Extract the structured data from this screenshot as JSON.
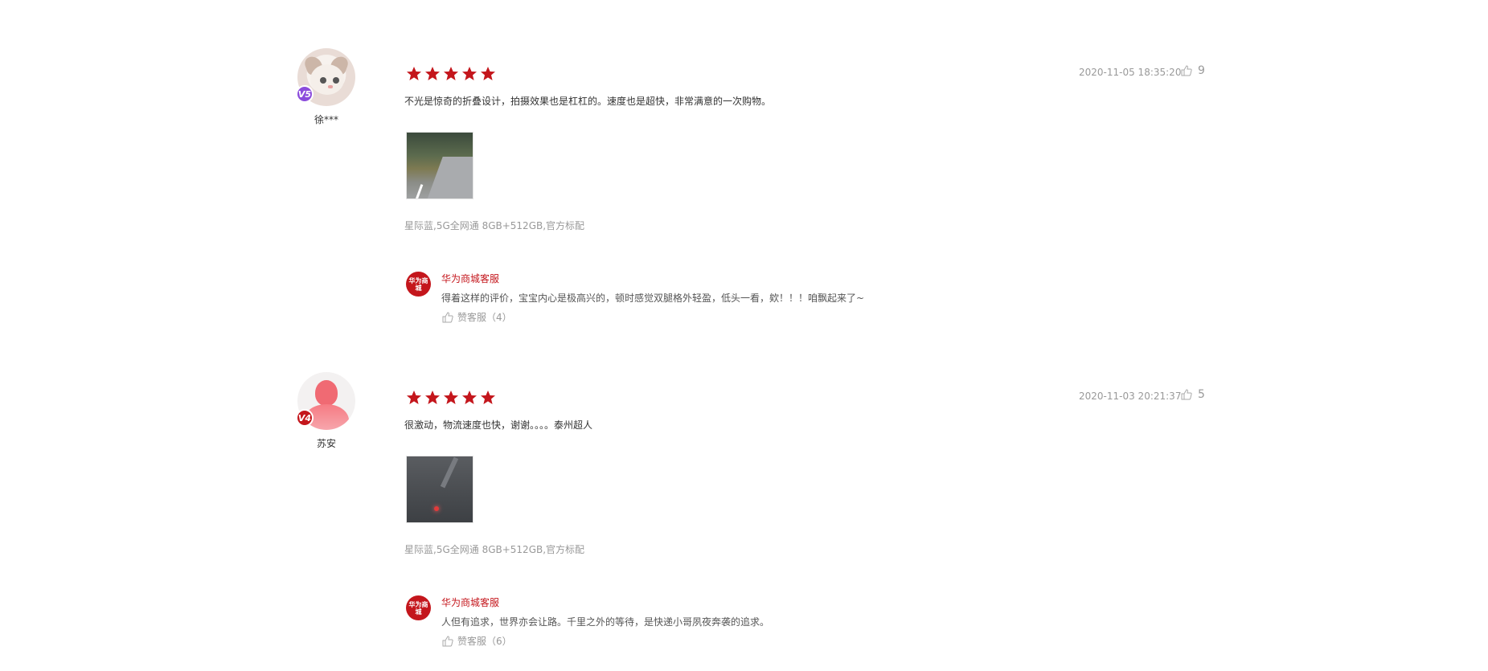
{
  "colors": {
    "accent": "#c4161c",
    "star": "#c4161c",
    "muted": "#999999",
    "vip_v5": "#8b4cdc",
    "vip_v4": "#c4161c"
  },
  "reviews": [
    {
      "username": "徐***",
      "vip": "V5",
      "avatar_icon": "cat-avatar",
      "rating": 5,
      "timestamp": "2020-11-05 18:35:20",
      "likes": "9",
      "content": "不光是惊奇的折叠设计，拍摄效果也是杠杠的。速度也是超快，非常满意的一次购物。",
      "spec": "星际蓝,5G全网通 8GB+512GB,官方标配",
      "reply": {
        "logo_text": "华为商城",
        "name": "华为商城客服",
        "text": "得着这样的评价，宝宝内心是极高兴的，顿时感觉双腿格外轻盈，低头一看，欸！！！咱飘起来了~",
        "like_label": "赞客服（4）"
      }
    },
    {
      "username": "苏安",
      "vip": "V4",
      "avatar_icon": "person-avatar",
      "rating": 5,
      "timestamp": "2020-11-03 20:21:37",
      "likes": "5",
      "content": "很激动，物流速度也快，谢谢。。。。泰州超人",
      "spec": "星际蓝,5G全网通 8GB+512GB,官方标配",
      "reply": {
        "logo_text": "华为商城",
        "name": "华为商城客服",
        "text": "人但有追求，世界亦会让路。千里之外的等待，是快递小哥夙夜奔袭的追求。",
        "like_label": "赞客服（6）"
      }
    }
  ]
}
